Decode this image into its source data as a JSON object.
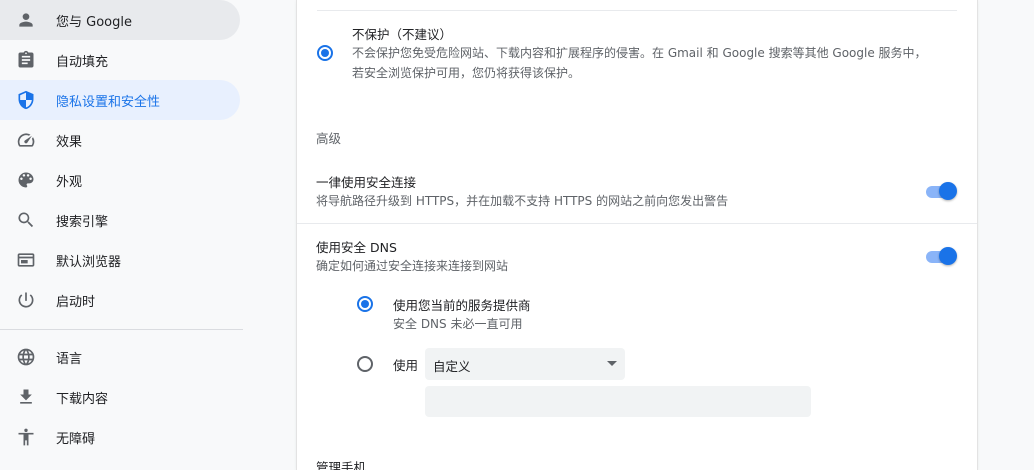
{
  "sidebar": {
    "items": [
      {
        "label": "您与 Google",
        "icon": "person-icon"
      },
      {
        "label": "自动填充",
        "icon": "clipboard-icon"
      },
      {
        "label": "隐私设置和安全性",
        "icon": "shield-icon"
      },
      {
        "label": "效果",
        "icon": "speedometer-icon"
      },
      {
        "label": "外观",
        "icon": "palette-icon"
      },
      {
        "label": "搜索引擎",
        "icon": "search-icon"
      },
      {
        "label": "默认浏览器",
        "icon": "browser-icon"
      },
      {
        "label": "启动时",
        "icon": "power-icon"
      },
      {
        "label": "语言",
        "icon": "globe-icon"
      },
      {
        "label": "下载内容",
        "icon": "download-icon"
      },
      {
        "label": "无障碍",
        "icon": "accessibility-icon"
      }
    ],
    "active_index": 2,
    "hover_index": 0
  },
  "main": {
    "no_protection": {
      "title": "不保护（不建议）",
      "desc_line1": "不会保护您免受危险网站、下载内容和扩展程序的侵害。在 Gmail 和 Google 搜索等其他 Google 服务中，",
      "desc_line2": "若安全浏览保护可用，您仍将获得该保护。",
      "selected": true
    },
    "advanced_heading": "高级",
    "https_first": {
      "title": "一律使用安全连接",
      "desc": "将导航路径升级到 HTTPS，并在加载不支持 HTTPS 的网站之前向您发出警告",
      "enabled": true
    },
    "secure_dns": {
      "title": "使用安全 DNS",
      "desc": "确定如何通过安全连接来连接到网站",
      "enabled": true,
      "current_provider": {
        "title": "使用您当前的服务提供商",
        "desc": "安全 DNS 未必一直可用",
        "selected": true
      },
      "custom": {
        "label": "使用",
        "selected_option": "自定义",
        "input_value": "",
        "selected": false
      }
    },
    "next_section_title": "管理手机"
  },
  "colors": {
    "accent": "#1a73e8",
    "active_bg": "#e8f0fe",
    "hover_bg": "#e8eaed",
    "toggle_track": "#8ab4f8"
  }
}
